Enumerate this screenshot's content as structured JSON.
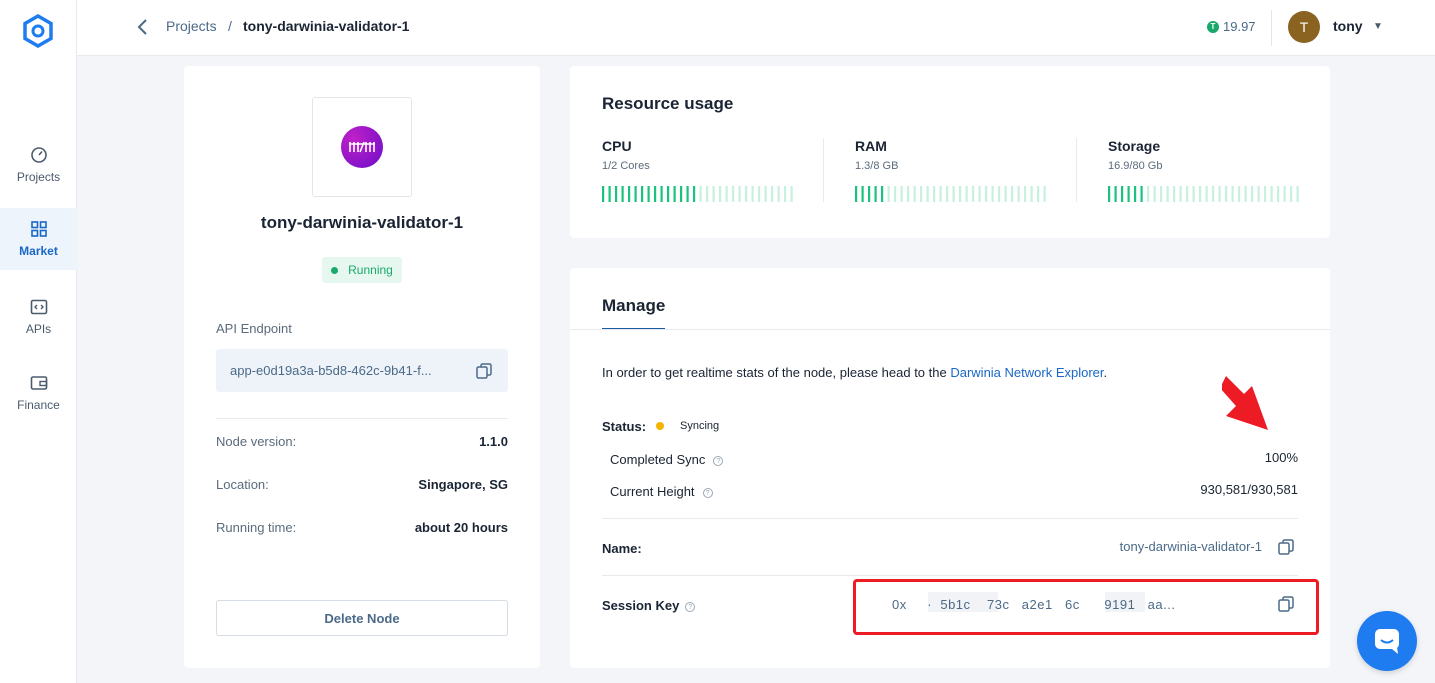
{
  "sidebar": {
    "items": [
      {
        "label": "Projects",
        "icon": "gauge-icon"
      },
      {
        "label": "Market",
        "icon": "grid-icon",
        "active": true
      },
      {
        "label": "APIs",
        "icon": "code-icon"
      },
      {
        "label": "Finance",
        "icon": "wallet-icon"
      }
    ]
  },
  "header": {
    "breadcrumb_parent": "Projects",
    "breadcrumb_sep": "/",
    "breadcrumb_current": "tony-darwinia-validator-1",
    "balance": "19.97",
    "avatar_initial": "T",
    "username": "tony"
  },
  "node": {
    "title": "tony-darwinia-validator-1",
    "status": "Running",
    "api_label": "API Endpoint",
    "api_value": "app-e0d19a3a-b5d8-462c-9b41-f...",
    "version_label": "Node version:",
    "version": "1.1.0",
    "location_label": "Location:",
    "location": "Singapore, SG",
    "runtime_label": "Running time:",
    "runtime": "about 20 hours",
    "delete_label": "Delete Node"
  },
  "resources": {
    "title": "Resource usage",
    "cpu": {
      "name": "CPU",
      "detail": "1/2 Cores",
      "fraction": 0.5
    },
    "ram": {
      "name": "RAM",
      "detail": "1.3/8 GB",
      "fraction": 0.1625
    },
    "storage": {
      "name": "Storage",
      "detail": "16.9/80 Gb",
      "fraction": 0.21
    }
  },
  "manage": {
    "tab": "Manage",
    "intro": "In order to get realtime stats of the node, please head to the ",
    "intro_link": "Darwinia Network Explorer",
    "intro_end": ".",
    "status_label": "Status:",
    "status_value": "Syncing",
    "sync_label": "Completed Sync",
    "sync_value": "100%",
    "height_label": "Current Height",
    "height_value": "930,581/930,581",
    "name_label": "Name:",
    "name_value": "tony-darwinia-validator-1",
    "session_label": "Session Key",
    "session_value": "0x     ·  5b1c    73c   a2e1   6c      9191   aa..."
  },
  "colors": {
    "accent": "#1967c7",
    "running": "#1aa86b",
    "syncing": "#f5b400",
    "annotation": "#ec1b24",
    "chat": "#1e7cf0"
  }
}
